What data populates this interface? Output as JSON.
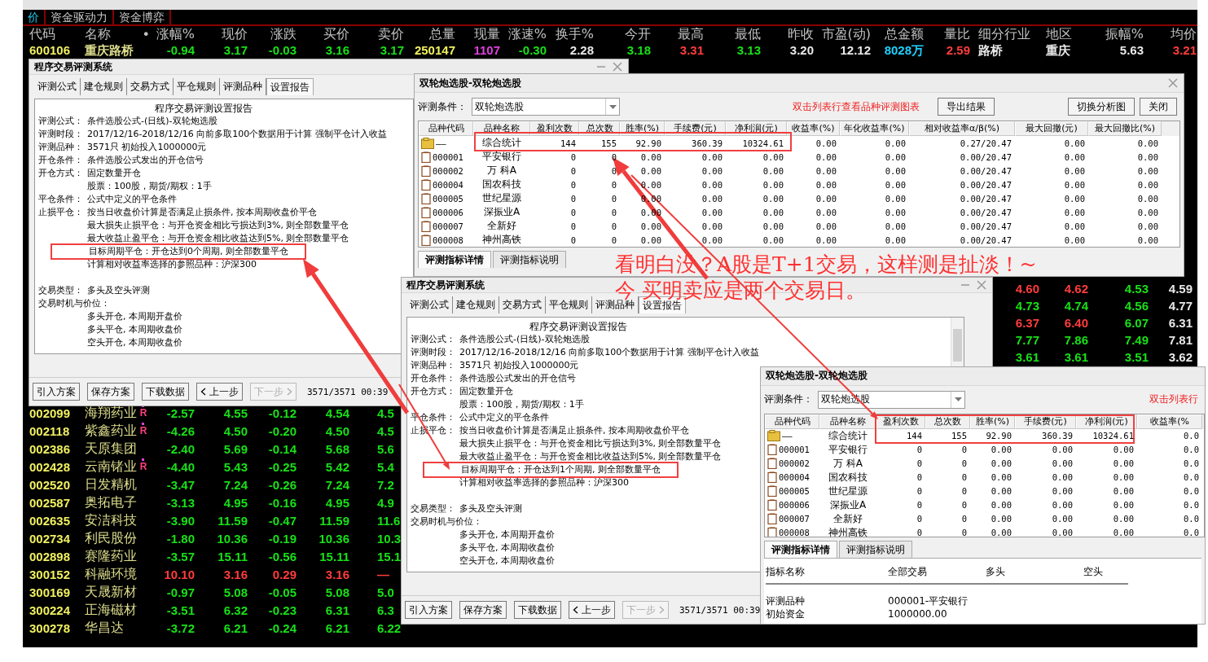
{
  "market": {
    "tabs": [
      {
        "label": "价",
        "selected": true
      },
      {
        "label": "资金驱动力",
        "selected": false
      },
      {
        "label": "资金博弈",
        "selected": false
      }
    ],
    "columns": [
      "代码",
      "名称",
      "•",
      "涨幅%",
      "现价",
      "涨跌",
      "买价",
      "卖价",
      "总量",
      "现量",
      "涨速%",
      "换手%",
      "今开",
      "最高",
      "最低",
      "昨收",
      "市盈(动)",
      "总金额",
      "量比",
      "细分行业",
      "地区",
      "振幅%",
      "均价"
    ],
    "top_row": [
      {
        "text": "600106",
        "color": "#f0f060"
      },
      {
        "text": "重庆路桥",
        "color": "#dcdc8c"
      },
      {
        "text": "-0.94",
        "color": "#18e018"
      },
      {
        "text": "3.17",
        "color": "#18e018"
      },
      {
        "text": "-0.03",
        "color": "#18e018"
      },
      {
        "text": "3.16",
        "color": "#18e018"
      },
      {
        "text": "3.17",
        "color": "#18e018"
      },
      {
        "text": "250147",
        "color": "#f0f060"
      },
      {
        "text": "1107",
        "color": "#e040e0"
      },
      {
        "text": "-0.30",
        "color": "#18e018"
      },
      {
        "text": "2.28",
        "color": "#e8e8e8"
      },
      {
        "text": "3.18",
        "color": "#18e018"
      },
      {
        "text": "3.31",
        "color": "#ff3c3c"
      },
      {
        "text": "3.13",
        "color": "#18e018"
      },
      {
        "text": "3.20",
        "color": "#e8e8e8"
      },
      {
        "text": "12.12",
        "color": "#e8e8e8"
      },
      {
        "text": "8028万",
        "color": "#20d0ff"
      },
      {
        "text": "2.59",
        "color": "#ff3c3c"
      },
      {
        "text": "路桥",
        "color": "#e8e8e8"
      },
      {
        "text": "重庆",
        "color": "#e8e8e8"
      },
      {
        "text": "5.63",
        "color": "#e8e8e8"
      },
      {
        "text": "3.21",
        "color": "#ff3c3c"
      }
    ],
    "side_rows": [
      [
        {
          "text": "4.60",
          "color": "#ff3c3c"
        },
        {
          "text": "4.62",
          "color": "#ff3c3c"
        },
        {
          "text": "4.53",
          "color": "#18e018"
        },
        {
          "text": "4.59",
          "color": "#e8e8e8"
        }
      ],
      [
        {
          "text": "4.73",
          "color": "#18e018"
        },
        {
          "text": "4.74",
          "color": "#18e018"
        },
        {
          "text": "4.56",
          "color": "#18e018"
        },
        {
          "text": "4.77",
          "color": "#e8e8e8"
        }
      ],
      [
        {
          "text": "6.37",
          "color": "#ff3c3c"
        },
        {
          "text": "6.40",
          "color": "#ff3c3c"
        },
        {
          "text": "6.07",
          "color": "#18e018"
        },
        {
          "text": "6.31",
          "color": "#e8e8e8"
        }
      ],
      [
        {
          "text": "7.77",
          "color": "#18e018"
        },
        {
          "text": "7.86",
          "color": "#18e018"
        },
        {
          "text": "7.49",
          "color": "#18e018"
        },
        {
          "text": "7.81",
          "color": "#e8e8e8"
        }
      ],
      [
        {
          "text": "3.61",
          "color": "#18e018"
        },
        {
          "text": "3.61",
          "color": "#18e018"
        },
        {
          "text": "3.51",
          "color": "#18e018"
        },
        {
          "text": "3.62",
          "color": "#e8e8e8"
        }
      ]
    ],
    "rows": [
      {
        "code": "002099",
        "name": "海翔药业",
        "flag": "R",
        "color": "#18e018",
        "values": [
          "-2.57",
          "4.55",
          "-0.12",
          "4.54",
          "4.5"
        ]
      },
      {
        "code": "002118",
        "name": "紫鑫药业",
        "flag": "R",
        "color": "#18e018",
        "values": [
          "-4.26",
          "4.50",
          "-0.20",
          "4.50",
          "4.5"
        ]
      },
      {
        "code": "002386",
        "name": "天原集团",
        "color": "#18e018",
        "values": [
          "-2.40",
          "5.69",
          "-0.14",
          "5.68",
          "5.6"
        ]
      },
      {
        "code": "002428",
        "name": "云南锗业",
        "flag": "R",
        "color": "#18e018",
        "values": [
          "-4.40",
          "5.43",
          "-0.25",
          "5.42",
          "5.4"
        ]
      },
      {
        "code": "002520",
        "name": "日发精机",
        "color": "#18e018",
        "values": [
          "-3.47",
          "7.24",
          "-0.26",
          "7.24",
          "7.2"
        ]
      },
      {
        "code": "002587",
        "name": "奥拓电子",
        "color": "#18e018",
        "values": [
          "-3.13",
          "4.95",
          "-0.16",
          "4.95",
          "4.9"
        ]
      },
      {
        "code": "002635",
        "name": "安洁科技",
        "color": "#18e018",
        "values": [
          "-3.90",
          "11.59",
          "-0.47",
          "11.59",
          "11.6"
        ]
      },
      {
        "code": "002734",
        "name": "利民股份",
        "color": "#18e018",
        "values": [
          "-1.80",
          "10.36",
          "-0.19",
          "10.36",
          "10.3"
        ]
      },
      {
        "code": "002898",
        "name": "赛隆药业",
        "color": "#18e018",
        "values": [
          "-3.57",
          "15.11",
          "-0.56",
          "15.11",
          "15.1"
        ]
      },
      {
        "code": "300152",
        "name": "科融环境",
        "color": "#ff3c3c",
        "values": [
          "10.10",
          "3.16",
          "0.29",
          "3.16",
          "—"
        ]
      },
      {
        "code": "300169",
        "name": "天晟新材",
        "color": "#18e018",
        "values": [
          "-0.97",
          "5.08",
          "-0.05",
          "5.08",
          "5.0"
        ]
      },
      {
        "code": "300224",
        "name": "正海磁材",
        "color": "#18e018",
        "values": [
          "-3.51",
          "6.32",
          "-0.23",
          "6.31",
          "6.3"
        ]
      },
      {
        "code": "300278",
        "name": "华昌达",
        "color": "#18e018",
        "values": [
          "-3.72",
          "6.21",
          "-0.24",
          "6.21",
          "6.22"
        ]
      }
    ]
  },
  "setup_window_1": {
    "title": "程序交易评测系统",
    "tabs": [
      {
        "label": "评测公式",
        "selected": false
      },
      {
        "label": "建仓规则",
        "selected": false
      },
      {
        "label": "交易方式",
        "selected": false
      },
      {
        "label": "平仓规则",
        "selected": false
      },
      {
        "label": "评测品种",
        "selected": false
      },
      {
        "label": "设置报告",
        "selected": true
      }
    ],
    "report": {
      "title": "程序交易评测设置报告",
      "lines": [
        {
          "label": "评测公式：",
          "text": "条件选股公式-(日线)-双轮炮选股"
        },
        {
          "label": "评测时段：",
          "text": "2017/12/16-2018/12/16 向前多取100个数据用于计算 强制平仓计入收益"
        },
        {
          "label": "评测品种：",
          "text": "3571只 初始投入1000000元"
        },
        {
          "label": "开仓条件：",
          "text": "条件选股公式发出的开仓信号"
        },
        {
          "label": "开仓方式：",
          "text": "固定数量开仓"
        },
        {
          "text": "股票：100股，期货/期权：1手"
        },
        {
          "label": "平仓条件：",
          "text": "公式中定义的平仓条件"
        },
        {
          "label": "止损平仓：",
          "text": "按当日收盘价计算是否满足止损条件, 按本周期收盘价平仓"
        },
        {
          "text": "最大损失止损平仓：与开仓资金相比亏损达到3%, 则全部数量平仓"
        },
        {
          "text": "最大收益止盈平仓：与开仓资金相比收益达到5%, 则全部数量平仓"
        },
        {
          "text": "目标周期平仓：开仓达到0个周期, 则全部数量平仓",
          "highlighted": true
        },
        {
          "text": "计算相对收益率选择的参照品种：沪深300"
        },
        {
          "label": "交易类型：",
          "text": "多头及空头评测"
        },
        {
          "label": "交易时机与价位："
        },
        {
          "text": "多头开仓, 本周期开盘价"
        },
        {
          "text": "多头平仓, 本周期收盘价"
        },
        {
          "text": "空头开仓, 本周期收盘价"
        }
      ]
    },
    "buttons": [
      {
        "label": "引入方案",
        "disabled": false,
        "kind": "text"
      },
      {
        "label": "保存方案",
        "disabled": false,
        "kind": "text"
      },
      {
        "label": "下载数据",
        "disabled": false,
        "kind": "text"
      },
      {
        "label": "上一步",
        "disabled": false,
        "kind": "back"
      },
      {
        "label": "下一步",
        "disabled": true,
        "kind": "forward"
      }
    ],
    "status": "3571/3571  00:39"
  },
  "result_window_1": {
    "title": "双轮炮选股-双轮炮选股",
    "condition_label": "评测条件：",
    "condition_value": "双轮炮选股",
    "hint": "双击列表行查看品种评测图表",
    "buttons": [
      "导出结果",
      "切换分析图",
      "关闭"
    ],
    "table": {
      "columns": [
        "品种代码",
        "品种名称",
        "盈利次数",
        "总次数",
        "胜率(%)",
        "手续费(元)",
        "净利润(元)",
        "收益率(%)",
        "年化收益率(%)",
        "相对收益率α/β(%)",
        "最大回撤(元)",
        "最大回撤比(%)"
      ],
      "rows": [
        {
          "kind": "summary",
          "code": "——",
          "name": "综合统计",
          "values": [
            "144",
            "155",
            "92.90",
            "360.39",
            "10324.61",
            "0.00",
            "0.00",
            "0.27/20.47",
            "0.00",
            "0.00"
          ]
        },
        {
          "kind": "item",
          "code": "000001",
          "name": "平安银行",
          "values": [
            "0",
            "0",
            "0.00",
            "0.00",
            "0.00",
            "0.00",
            "0.00",
            "0.00/20.47",
            "0.00",
            "0.00"
          ]
        },
        {
          "kind": "item",
          "code": "000002",
          "name": "万 科A",
          "values": [
            "0",
            "0",
            "0.00",
            "0.00",
            "0.00",
            "0.00",
            "0.00",
            "0.00/20.47",
            "0.00",
            "0.00"
          ]
        },
        {
          "kind": "item",
          "code": "000004",
          "name": "国农科技",
          "values": [
            "0",
            "0",
            "0.00",
            "0.00",
            "0.00",
            "0.00",
            "0.00",
            "0.00/20.47",
            "0.00",
            "0.00"
          ]
        },
        {
          "kind": "item",
          "code": "000005",
          "name": "世纪星源",
          "values": [
            "0",
            "0",
            "0.00",
            "0.00",
            "0.00",
            "0.00",
            "0.00",
            "0.00/20.47",
            "0.00",
            "0.00"
          ]
        },
        {
          "kind": "item",
          "code": "000006",
          "name": "深振业A",
          "values": [
            "0",
            "0",
            "0.00",
            "0.00",
            "0.00",
            "0.00",
            "0.00",
            "0.00/20.47",
            "0.00",
            "0.00"
          ]
        },
        {
          "kind": "item",
          "code": "000007",
          "name": "全新好",
          "values": [
            "0",
            "0",
            "0.00",
            "0.00",
            "0.00",
            "0.00",
            "0.00",
            "0.00/20.47",
            "0.00",
            "0.00"
          ]
        },
        {
          "kind": "item",
          "code": "000008",
          "name": "神州高铁",
          "values": [
            "0",
            "0",
            "0.00",
            "0.00",
            "0.00",
            "0.00",
            "0.00",
            "0.00/20.47",
            "0.00",
            "0.00"
          ]
        }
      ]
    },
    "bottom_tabs": [
      {
        "label": "评测指标详情",
        "selected": true
      },
      {
        "label": "评测指标说明",
        "selected": false
      }
    ]
  },
  "setup_window_2": {
    "title": "程序交易评测系统",
    "tabs": [
      {
        "label": "评测公式",
        "selected": false
      },
      {
        "label": "建仓规则",
        "selected": false
      },
      {
        "label": "交易方式",
        "selected": false
      },
      {
        "label": "平仓规则",
        "selected": false
      },
      {
        "label": "评测品种",
        "selected": false
      },
      {
        "label": "设置报告",
        "selected": true
      }
    ],
    "report": {
      "title": "程序交易评测设置报告",
      "lines": [
        {
          "label": "评测公式：",
          "text": "条件选股公式-(日线)-双轮炮选股"
        },
        {
          "label": "评测时段：",
          "text": "2017/12/16-2018/12/16 向前多取100个数据用于计算 强制平仓计入收益"
        },
        {
          "label": "评测品种：",
          "text": "3571只 初始投入1000000元"
        },
        {
          "label": "开仓条件：",
          "text": "条件选股公式发出的开仓信号"
        },
        {
          "label": "开仓方式：",
          "text": "固定数量开仓"
        },
        {
          "text": "股票：100股，期货/期权：1手"
        },
        {
          "label": "平仓条件：",
          "text": "公式中定义的平仓条件"
        },
        {
          "label": "止损平仓：",
          "text": "按当日收盘价计算是否满足止损条件, 按本周期收盘价平仓"
        },
        {
          "text": "最大损失止损平仓：与开仓资金相比亏损达到3%, 则全部数量平仓"
        },
        {
          "text": "最大收益止盈平仓：与开仓资金相比收益达到5%, 则全部数量平仓"
        },
        {
          "text": "目标周期平仓：开仓达到1个周期, 则全部数量平仓",
          "highlighted": true
        },
        {
          "text": "计算相对收益率选择的参照品种：沪深300"
        },
        {
          "label": "交易类型：",
          "text": "多头及空头评测"
        },
        {
          "label": "交易时机与价位："
        },
        {
          "text": "多头开仓, 本周期开盘价"
        },
        {
          "text": "多头平仓, 本周期收盘价"
        },
        {
          "text": "空头开仓, 本周期收盘价"
        }
      ]
    },
    "buttons": [
      {
        "label": "引入方案",
        "disabled": false,
        "kind": "text"
      },
      {
        "label": "保存方案",
        "disabled": false,
        "kind": "text"
      },
      {
        "label": "下载数据",
        "disabled": false,
        "kind": "text"
      },
      {
        "label": "上一步",
        "disabled": false,
        "kind": "back"
      },
      {
        "label": "下一步",
        "disabled": true,
        "kind": "forward"
      }
    ],
    "status": "3571/3571  00:39"
  },
  "result_window_2": {
    "title": "双轮炮选股-双轮炮选股",
    "condition_label": "评测条件：",
    "condition_value": "双轮炮选股",
    "hint": "双击列表行",
    "table": {
      "columns": [
        "品种代码",
        "品种名称",
        "盈利次数",
        "总次数",
        "胜率(%)",
        "手续费(元)",
        "净利润(元)",
        "收益率(%"
      ],
      "rows": [
        {
          "kind": "summary",
          "code": "——",
          "name": "综合统计",
          "values": [
            "144",
            "155",
            "92.90",
            "360.39",
            "10324.61",
            "0.0"
          ]
        },
        {
          "kind": "item",
          "code": "000001",
          "name": "平安银行",
          "values": [
            "0",
            "0",
            "0.00",
            "0.00",
            "0.00",
            "0.0"
          ]
        },
        {
          "kind": "item",
          "code": "000002",
          "name": "万 科A",
          "values": [
            "0",
            "0",
            "0.00",
            "0.00",
            "0.00",
            "0.0"
          ]
        },
        {
          "kind": "item",
          "code": "000004",
          "name": "国农科技",
          "values": [
            "0",
            "0",
            "0.00",
            "0.00",
            "0.00",
            "0.0"
          ]
        },
        {
          "kind": "item",
          "code": "000005",
          "name": "世纪星源",
          "values": [
            "0",
            "0",
            "0.00",
            "0.00",
            "0.00",
            "0.0"
          ]
        },
        {
          "kind": "item",
          "code": "000006",
          "name": "深振业A",
          "values": [
            "0",
            "0",
            "0.00",
            "0.00",
            "0.00",
            "0.0"
          ]
        },
        {
          "kind": "item",
          "code": "000007",
          "name": "全新好",
          "values": [
            "0",
            "0",
            "0.00",
            "0.00",
            "0.00",
            "0.0"
          ]
        },
        {
          "kind": "item",
          "code": "000008",
          "name": "神州高铁",
          "values": [
            "0",
            "0",
            "0.00",
            "0.00",
            "0.00",
            "0.0"
          ]
        }
      ]
    },
    "bottom_tabs": [
      {
        "label": "评测指标详情",
        "selected": true
      },
      {
        "label": "评测指标说明",
        "selected": false
      }
    ],
    "detail": {
      "columns": [
        "指标名称",
        "全部交易",
        "多头",
        "空头"
      ],
      "rows": [
        [
          "评测品种",
          "000001-平安银行"
        ],
        [
          "初始资金",
          "1000000.00"
        ]
      ]
    }
  },
  "annotation": {
    "lines": [
      "看明白没？A股是T+1交易，这样测是扯淡！~",
      "今 买明卖应是两个交易日。"
    ]
  }
}
